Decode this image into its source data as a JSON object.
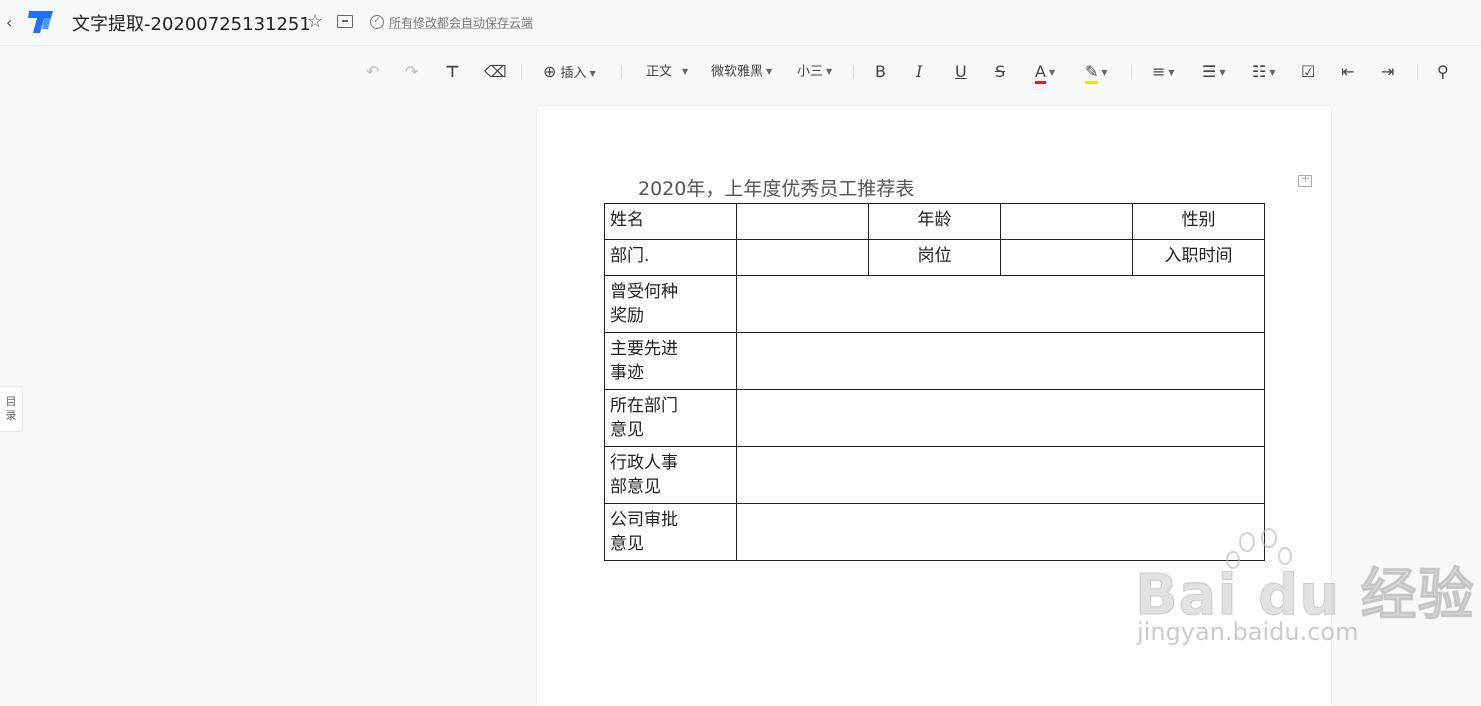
{
  "header": {
    "back_icon": "‹",
    "title": "文字提取-20200725131251",
    "star_icon": "☆",
    "save_check": "✓",
    "save_status": "所有修改都会自动保存云端"
  },
  "toolbar": {
    "undo": "↶",
    "redo": "↷",
    "format_painter": "⊤",
    "eraser": "⌫",
    "insert_label": "插入",
    "style_label": "正文",
    "font_label": "微软雅黑",
    "size_label": "小三",
    "bold": "B",
    "italic": "I",
    "underline": "U",
    "strike": "S",
    "font_color_glyph": "A",
    "font_color": "#e02020",
    "highlight_color": "#f5e000",
    "align": "≡",
    "bullet_list": "☰",
    "numbered_list": "☷",
    "checklist": "☑",
    "indent_dec": "⇤",
    "indent_inc": "⇥",
    "search": "⚲"
  },
  "sidebar": {
    "toc_label_1": "目",
    "toc_label_2": "录"
  },
  "document": {
    "table_title": "2020年，上年度优秀员工推荐表",
    "row1": [
      "姓名",
      "",
      "年龄",
      "",
      "性别"
    ],
    "row2": [
      "部门.",
      "",
      "岗位",
      "",
      "入职时间"
    ],
    "rows": [
      {
        "label_1": "曾受何种",
        "label_2": "奖励"
      },
      {
        "label_1": "主要先进",
        "label_2": "事迹"
      },
      {
        "label_1": "所在部门",
        "label_2": "意见"
      },
      {
        "label_1": "行政人事",
        "label_2": "部意见"
      },
      {
        "label_1": "公司审批",
        "label_2": "意见"
      }
    ]
  },
  "watermark": {
    "main": "Bai  du 经验",
    "sub": "jingyan.baidu.com"
  }
}
